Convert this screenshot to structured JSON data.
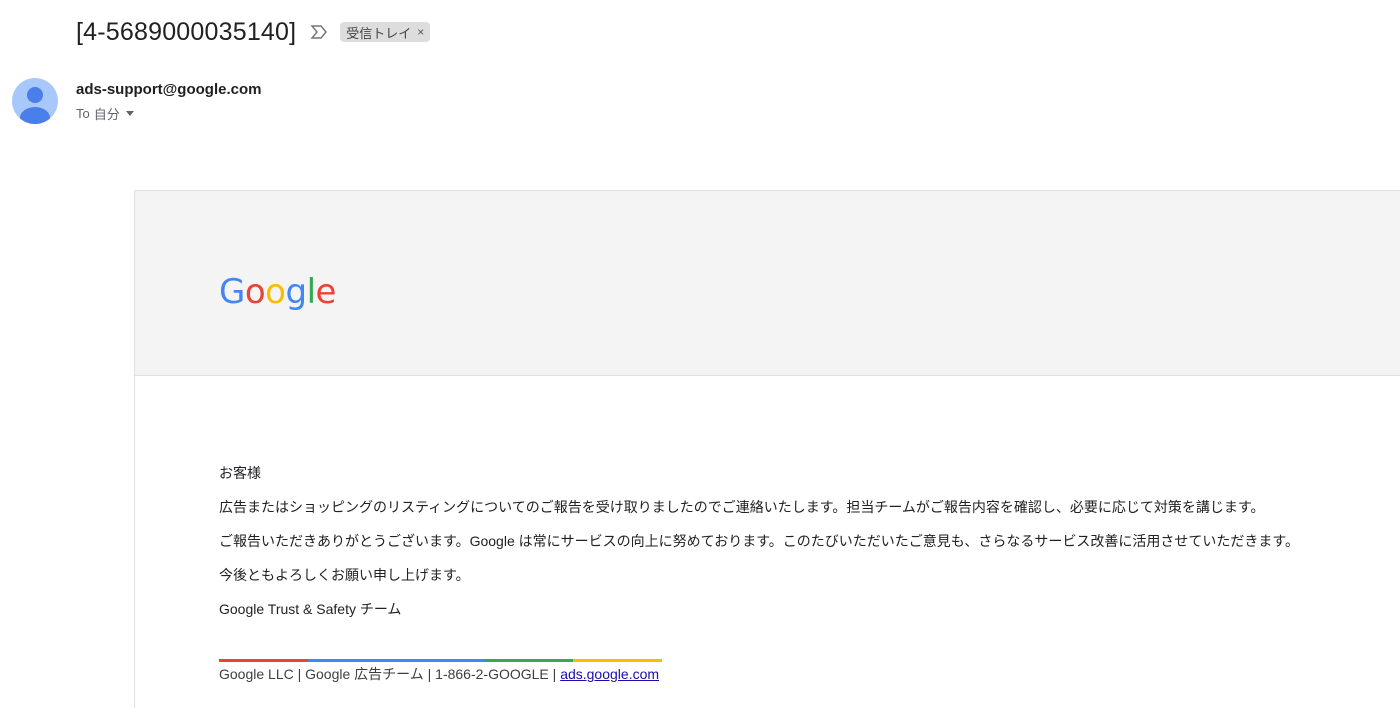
{
  "email": {
    "subject": "[4-5689000035140]",
    "label_chip": "受信トレイ",
    "label_chip_close": "×"
  },
  "sender": {
    "email": "ads-support@google.com",
    "recipient_prefix": "To",
    "recipient": "自分"
  },
  "body": {
    "logo_letters": [
      "G",
      "o",
      "o",
      "g",
      "l",
      "e"
    ],
    "greeting": "お客様",
    "paragraph1": "広告またはショッピングのリスティングについてのご報告を受け取りましたのでご連絡いたします。担当チームがご報告内容を確認し、必要に応じて対策を講じます。",
    "paragraph2": "ご報告いただきありがとうございます。Google は常にサービスの向上に努めております。このたびいただいたご意見も、さらなるサービス改善に活用させていただきます。",
    "closing": "今後ともよろしくお願い申し上げます。",
    "signature": "Google Trust & Safety チーム"
  },
  "footer": {
    "text": "Google LLC | Google 広告チーム | 1-866-2-GOOGLE | ",
    "link": "ads.google.com"
  },
  "colors": {
    "google_blue": "#4285F4",
    "google_red": "#EA4335",
    "google_yellow": "#FBBC05",
    "google_green": "#34A853",
    "avatar_bg": "#a8c7fa",
    "avatar_fg": "#4a7ee8"
  }
}
